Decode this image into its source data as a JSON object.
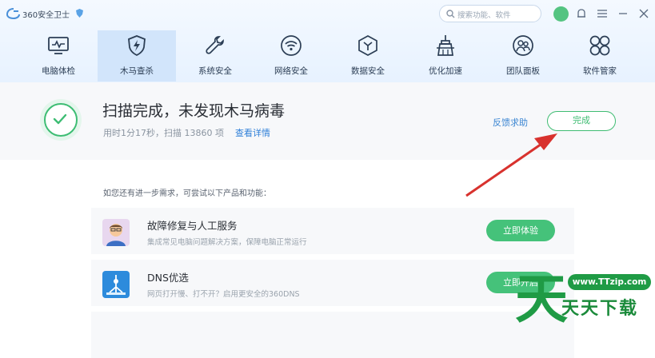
{
  "app": {
    "title": "360安全卫士"
  },
  "search": {
    "placeholder": "搜索功能、软件"
  },
  "nav": [
    {
      "label": "电脑体检",
      "icon": "monitor-icon"
    },
    {
      "label": "木马查杀",
      "icon": "lightning-shield-icon"
    },
    {
      "label": "系统安全",
      "icon": "wrench-icon"
    },
    {
      "label": "网络安全",
      "icon": "wifi-icon"
    },
    {
      "label": "数据安全",
      "icon": "hexagon-y-icon"
    },
    {
      "label": "优化加速",
      "icon": "broom-icon"
    },
    {
      "label": "团队面板",
      "icon": "team-icon"
    },
    {
      "label": "软件管家",
      "icon": "apps-icon"
    }
  ],
  "status": {
    "title": "扫描完成，未发现木马病毒",
    "subtitle": "用时1分17秒，扫描 13860 项",
    "details_link": "查看详情",
    "feedback_link": "反馈求助",
    "done_button": "完成"
  },
  "hint": "如您还有进一步需求，可尝试以下产品和功能：",
  "products": [
    {
      "title": "故障修复与人工服务",
      "desc": "集成常见电脑问题解决方案，保障电脑正常运行",
      "button": "立即体验",
      "icon": "engineer-avatar-icon"
    },
    {
      "title": "DNS优选",
      "desc": "网页打开慢、打不开？启用更安全的360DNS",
      "button": "立即开启",
      "icon": "dns-globe-icon"
    }
  ],
  "watermark": {
    "url": "www.TTzip.com",
    "text": "天天下载",
    "logo": "天"
  },
  "colors": {
    "accent_green": "#45c27a",
    "link_blue": "#2f7fd8",
    "arrow_red": "#d8322e"
  }
}
